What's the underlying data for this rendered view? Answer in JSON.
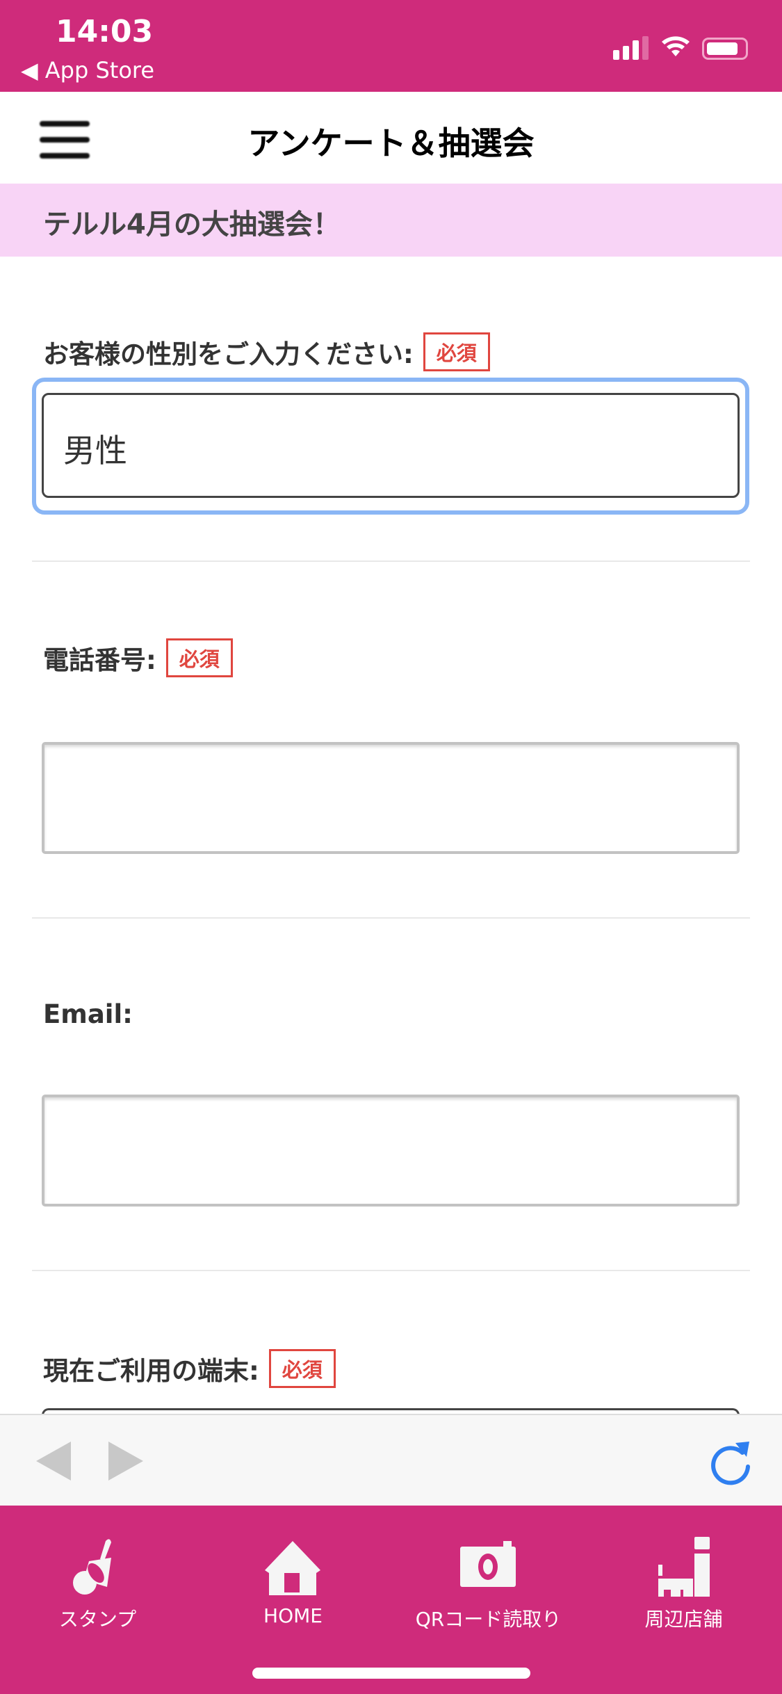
{
  "status_bar": {
    "time": "14:03",
    "back_label": "◀ App Store"
  },
  "header": {
    "title": "アンケート＆抽選会",
    "menu_icon": "hamburger-icon"
  },
  "banner": {
    "text": "テルル4月の大抽選会！"
  },
  "form": {
    "required_badge": "必須",
    "fields": [
      {
        "label": "お客様の性別をご入力ください:",
        "required": true,
        "type": "select",
        "value": "男性",
        "focused": true
      },
      {
        "label": "電話番号:",
        "required": true,
        "type": "text",
        "value": ""
      },
      {
        "label": "Email:",
        "required": false,
        "type": "text",
        "value": ""
      },
      {
        "label": "現在ご利用の端末:",
        "required": true,
        "type": "select",
        "value": ""
      }
    ]
  },
  "toolbar": {
    "back_icon": "triangle-left-icon",
    "forward_icon": "triangle-right-icon",
    "reload_icon": "reload-icon",
    "reload_color": "#2f7ff0"
  },
  "tabbar": {
    "color": "#cf2b7b",
    "items": [
      {
        "label": "スタンプ",
        "icon": "stamp-icon"
      },
      {
        "label": "HOME",
        "icon": "home-icon"
      },
      {
        "label": "QRコード読取り",
        "icon": "camera-icon"
      },
      {
        "label": "周辺店舗",
        "icon": "map-pin-icon"
      }
    ]
  }
}
